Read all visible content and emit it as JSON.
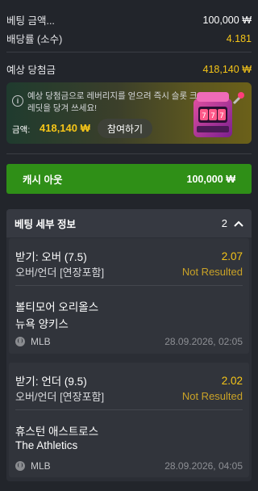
{
  "summary": {
    "bet_amount_label": "베팅 금액...",
    "bet_amount_value": "100,000 ₩",
    "odds_label": "배당률 (소수)",
    "odds_value": "4.181",
    "expected_label": "예상 당첨금",
    "expected_value": "418,140 ₩"
  },
  "promo": {
    "message": "예상 당첨금으로 레버리지를 얻으려 즉시 슬롯 크레딧을 당겨 쓰세요!",
    "amount_label": "금액:",
    "amount_value": "418,140 ₩",
    "join_label": "참여하기",
    "slot_icon": "slot-machine-icon"
  },
  "cashout": {
    "label": "캐시 아웃",
    "value": "100,000 ₩"
  },
  "details": {
    "title": "베팅 세부 정보",
    "count": "2",
    "collapse_icon": "chevron-up-icon",
    "bets": [
      {
        "pick": "받기: 오버 (7.5)",
        "odds": "2.07",
        "market": "오버/언더 [연장포함]",
        "status": "Not Resulted",
        "home": "볼티모어 오리올스",
        "away": "뉴욕 양키스",
        "sport_icon": "baseball-icon",
        "league": "MLB",
        "datetime": "28.09.2026, 02:05"
      },
      {
        "pick": "받기: 언더 (9.5)",
        "odds": "2.02",
        "market": "오버/언더 [연장포함]",
        "status": "Not Resulted",
        "home": "휴스턴 애스트로스",
        "away": "The Athletics",
        "sport_icon": "baseball-icon",
        "league": "MLB",
        "datetime": "28.09.2026, 04:05"
      }
    ]
  },
  "colors": {
    "background": "#22252b",
    "accent_yellow": "#f5c518",
    "cashout_green": "#2f8f17",
    "status_gold": "#c9a227"
  }
}
